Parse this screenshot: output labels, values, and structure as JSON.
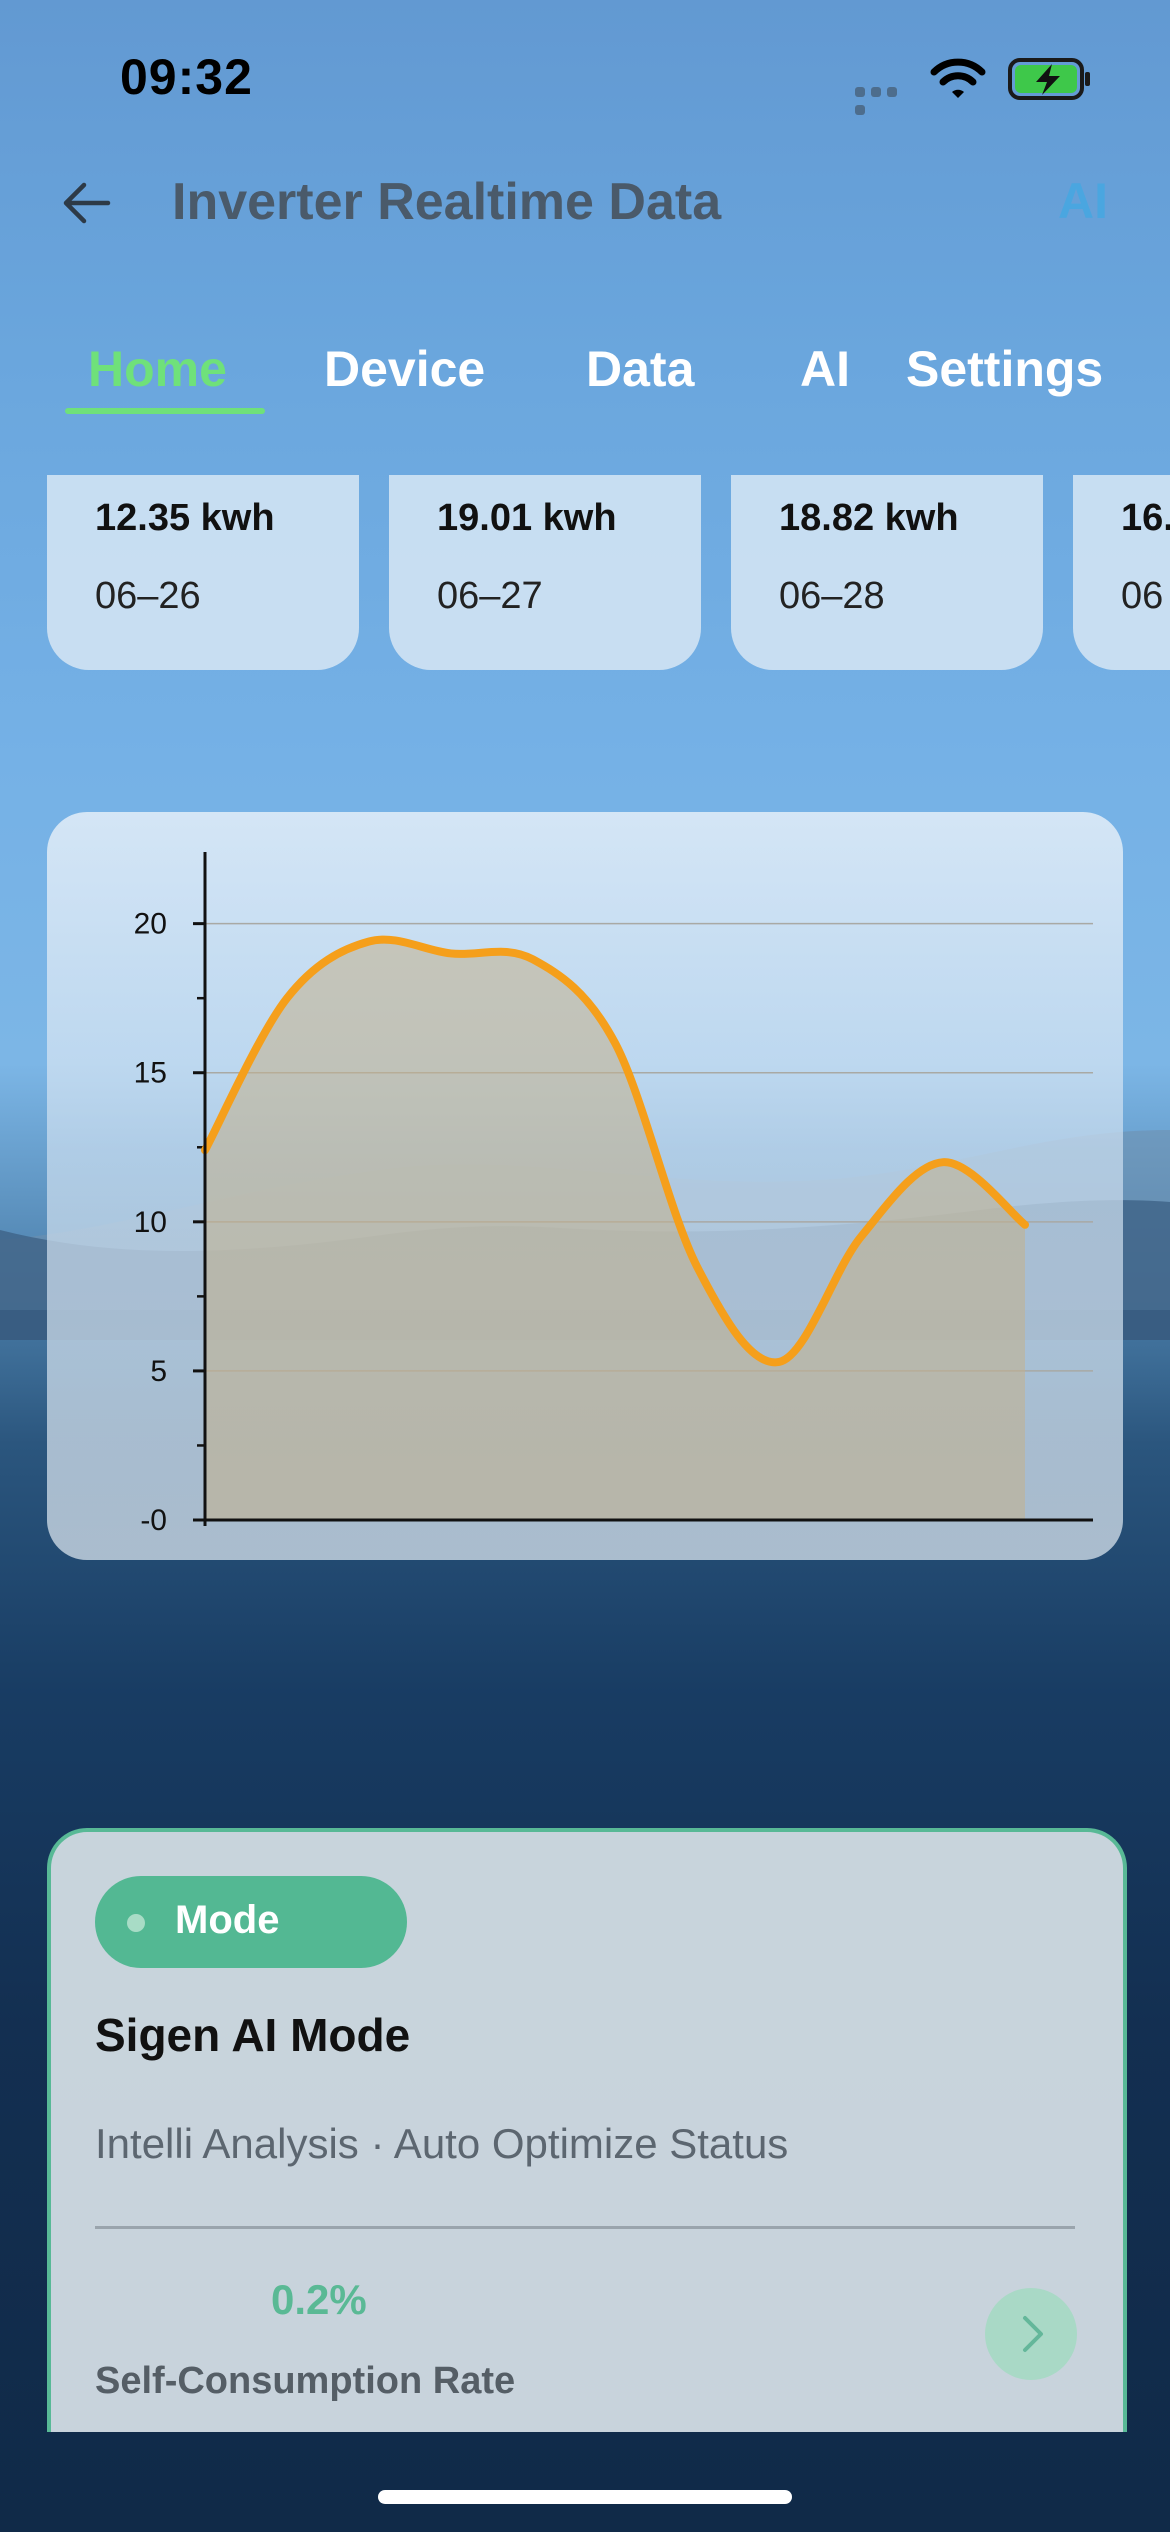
{
  "status_bar": {
    "time": "09:32"
  },
  "header": {
    "title": "Inverter Realtime Data",
    "ai_link": "AI"
  },
  "tabs": [
    {
      "label": "Home",
      "active": true
    },
    {
      "label": "Device",
      "active": false
    },
    {
      "label": "Data",
      "active": false
    },
    {
      "label": "AI",
      "active": false
    },
    {
      "label": "Settings",
      "active": false
    }
  ],
  "daily_cards": [
    {
      "energy": "12.35 kwh",
      "date": "06–26"
    },
    {
      "energy": "19.01 kwh",
      "date": "06–27"
    },
    {
      "energy": "18.82 kwh",
      "date": "06–28"
    },
    {
      "energy": "16.",
      "date": "06"
    }
  ],
  "chart_data": {
    "type": "area",
    "x": [
      0,
      1,
      2,
      3,
      4,
      5,
      6,
      7,
      8,
      9,
      10
    ],
    "values": [
      12.4,
      17.5,
      19.4,
      19.0,
      18.8,
      16.0,
      8.5,
      5.3,
      9.5,
      12.0,
      9.9
    ],
    "yticks": [
      0,
      5,
      10,
      15,
      20
    ],
    "ytick_labels": [
      "-0",
      "5",
      "10",
      "15",
      "20"
    ],
    "ylim": [
      0,
      22
    ],
    "grid": true,
    "line_color": "#f59f1b",
    "fill_color": "#c3b08d"
  },
  "mode_card": {
    "badge": "Mode",
    "title": "Sigen AI Mode",
    "subtitle": "Intelli Analysis · Auto Optimize Status",
    "rate_value": "0.2%",
    "rate_label": "Self-Consumption Rate"
  },
  "colors": {
    "accent_green": "#6fe17a",
    "mode_green": "#53b893",
    "ai_blue": "#4aa6e0"
  }
}
